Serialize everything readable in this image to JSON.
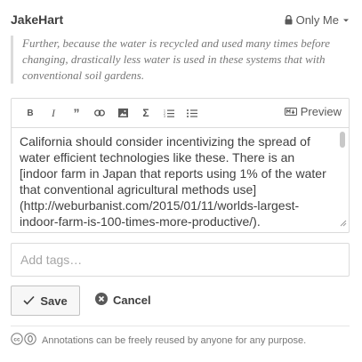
{
  "header": {
    "username": "JakeHart",
    "privacy_label": "Only Me",
    "icons": [
      "lock-icon",
      "caret-down-icon"
    ]
  },
  "quote": {
    "text": "Further, because the water is recycled and used many times before changing, drastically less water is used in these systems that with conventional soil gardens."
  },
  "toolbar": {
    "buttons": [
      {
        "name": "bold",
        "glyph": "B"
      },
      {
        "name": "italic",
        "glyph": "I"
      },
      {
        "name": "quote",
        "glyph": "”"
      },
      {
        "name": "link",
        "glyph": "link"
      },
      {
        "name": "image",
        "glyph": "image"
      },
      {
        "name": "math",
        "glyph": "Σ"
      },
      {
        "name": "numbered-list",
        "glyph": "ol"
      },
      {
        "name": "bullet-list",
        "glyph": "ul"
      }
    ],
    "preview_label": "Preview"
  },
  "editor": {
    "text": "California should consider incentivizing the spread of water efficient technologies like these. There is an [indoor farm in Japan that reports using 1% of the water that conventional agricultural methods use](http://weburbanist.com/2015/01/11/worlds-largest-indoor-farm-is-100-times-more-productive/)."
  },
  "tags": {
    "placeholder": "Add tags…"
  },
  "actions": {
    "save_label": "Save",
    "cancel_label": "Cancel"
  },
  "footer": {
    "license_text": "Annotations can be freely reused by anyone for any purpose."
  }
}
